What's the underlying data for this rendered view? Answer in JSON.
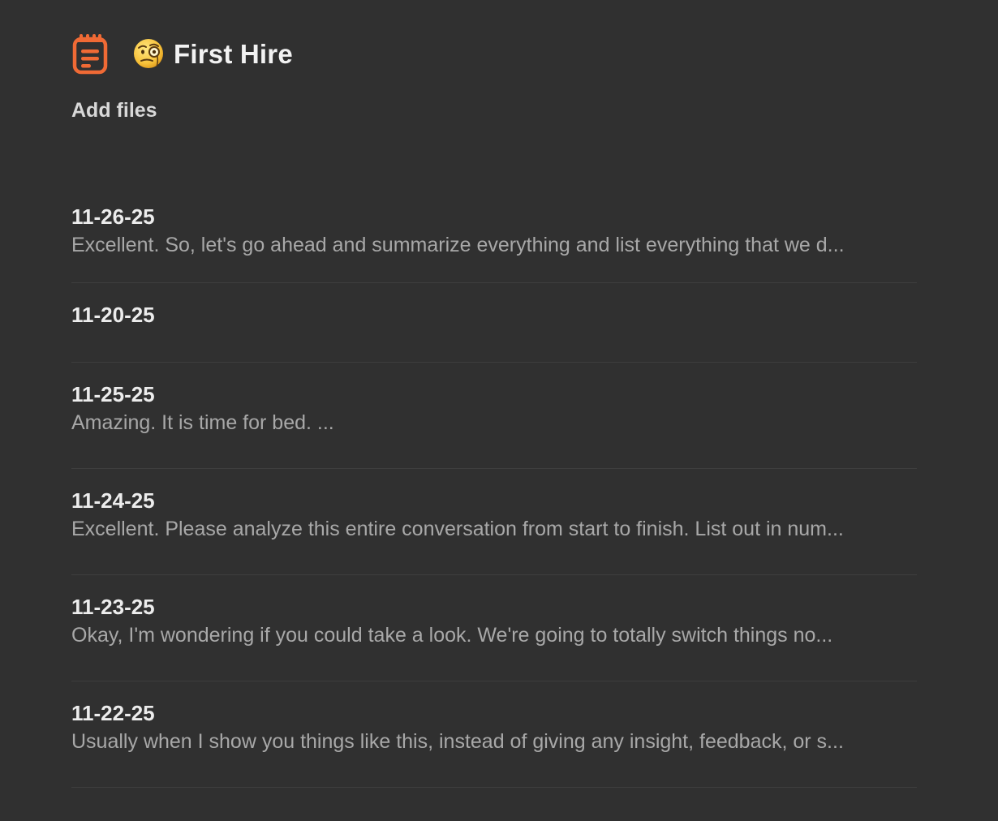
{
  "header": {
    "notes_icon": "notes-icon",
    "emoji": "face-with-monocle",
    "title": "First Hire",
    "accent_color": "#f06a35"
  },
  "add_files_label": "Add files",
  "notes": [
    {
      "date": "11-26-25",
      "preview": "Excellent. So, let's go ahead and summarize everything and list everything that we d..."
    },
    {
      "date": "11-20-25",
      "preview": ""
    },
    {
      "date": "11-25-25",
      "preview": "Amazing. It is time for bed.  ..."
    },
    {
      "date": "11-24-25",
      "preview": "Excellent. Please analyze this entire conversation from start to finish. List out in num..."
    },
    {
      "date": "11-23-25",
      "preview": "Okay, I'm wondering if you could take a look. We're going to totally switch things no..."
    },
    {
      "date": "11-22-25",
      "preview": "Usually when I show you things like this, instead of giving any insight, feedback, or s..."
    }
  ]
}
